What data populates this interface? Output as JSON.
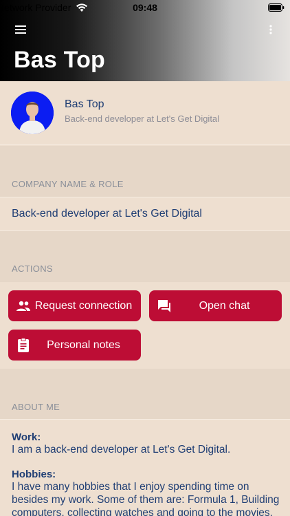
{
  "status_bar": {
    "carrier": "Network Provider",
    "time": "09:48"
  },
  "header": {
    "title": "Bas Top",
    "menu_icon": "hamburger-menu-icon",
    "more_icon": "more-vertical-icon"
  },
  "profile": {
    "name": "Bas Top",
    "role": "Back-end developer at Let's Get Digital"
  },
  "company": {
    "section_title": "COMPANY NAME & ROLE",
    "value": "Back-end developer at Let's Get Digital"
  },
  "actions": {
    "section_title": "ACTIONS",
    "request_connection": "Request connection",
    "open_chat": "Open chat",
    "personal_notes": "Personal notes"
  },
  "about": {
    "section_title": "ABOUT ME",
    "work_label": "Work:",
    "work_text": "I am a back-end developer at Let's Get Digital.",
    "hobbies_label": "Hobbies:",
    "hobbies_text": "I have many hobbies that I enjoy spending time on besides my work. Some of them are: Formula 1, Building computers, collecting watches and going to the movies."
  },
  "colors": {
    "accent": "#bd0d35",
    "text_primary": "#1f3e74",
    "background": "#eedfd0",
    "avatar_bg": "#0b1df2"
  }
}
